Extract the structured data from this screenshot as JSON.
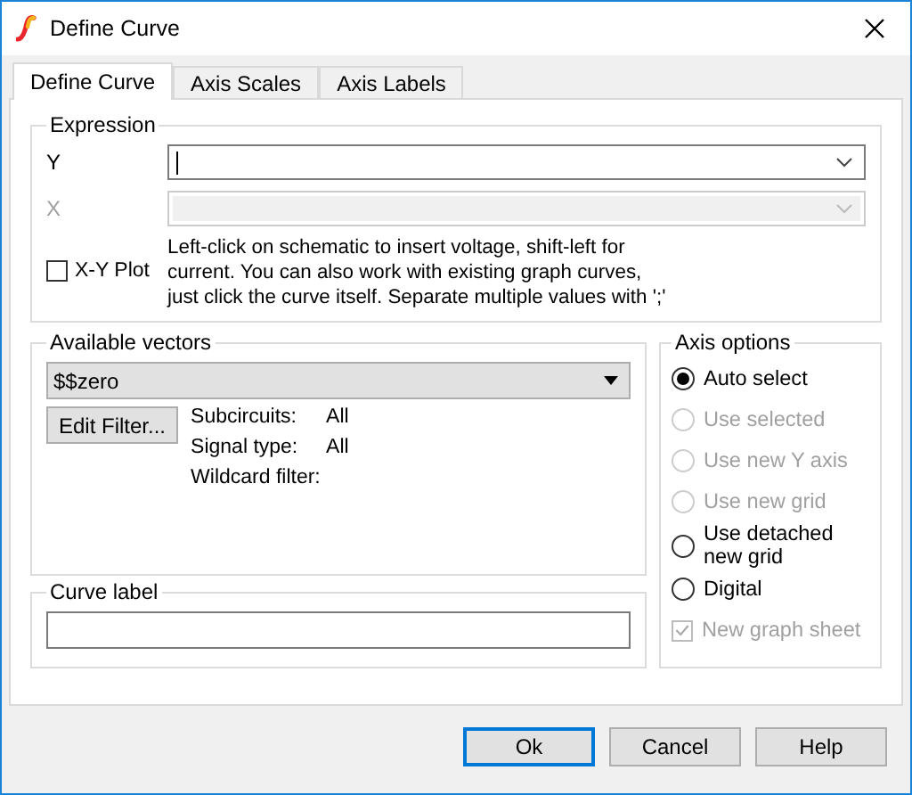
{
  "window": {
    "title": "Define Curve"
  },
  "tabs": [
    {
      "label": "Define Curve",
      "selected": true
    },
    {
      "label": "Axis Scales",
      "selected": false
    },
    {
      "label": "Axis Labels",
      "selected": false
    }
  ],
  "expression": {
    "title": "Expression",
    "y_label": "Y",
    "x_label": "X",
    "x_disabled": true,
    "xy_plot": {
      "label": "X-Y Plot",
      "checked": false
    },
    "hint": "Left-click on schematic to insert voltage, shift-left for current. You can also work with existing graph curves, just click the curve itself. Separate multiple values with ';'"
  },
  "available_vectors": {
    "title": "Available vectors",
    "selection": "$$zero",
    "edit_button": "Edit Filter...",
    "filters": [
      {
        "name": "Subcircuits:",
        "value": "All"
      },
      {
        "name": "Signal type:",
        "value": "All"
      },
      {
        "name": "Wildcard filter:"
      }
    ]
  },
  "curve_label": {
    "title": "Curve label"
  },
  "axis_options": {
    "title": "Axis options",
    "items": [
      {
        "kind": "radio",
        "label": "Auto select",
        "selected": true,
        "disabled": false
      },
      {
        "kind": "radio",
        "label": "Use selected",
        "selected": false,
        "disabled": true
      },
      {
        "kind": "radio",
        "label": "Use new Y axis",
        "selected": false,
        "disabled": true
      },
      {
        "kind": "radio",
        "label": "Use new grid",
        "selected": false,
        "disabled": true
      },
      {
        "kind": "radio",
        "label": "Use detached new grid",
        "selected": false,
        "disabled": false
      },
      {
        "kind": "radio",
        "label": "Digital",
        "selected": false,
        "disabled": false
      },
      {
        "kind": "checkbox",
        "label": "New graph sheet",
        "checked": true,
        "disabled": true
      }
    ]
  },
  "buttons": [
    {
      "label": "Ok",
      "default": true
    },
    {
      "label": "Cancel",
      "default": false
    },
    {
      "label": "Help",
      "default": false
    }
  ]
}
